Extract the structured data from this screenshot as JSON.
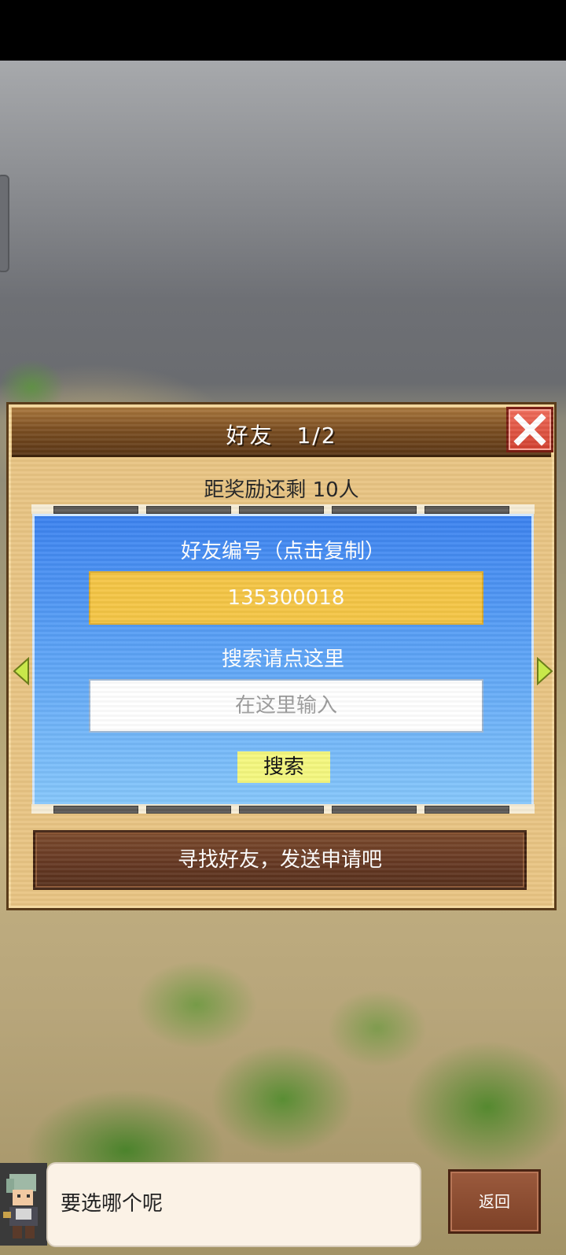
{
  "dialog": {
    "title": "好友　1/2",
    "reward_remaining": "距奖励还剩 10人",
    "friend_code_label": "好友编号（点击复制）",
    "friend_code": "135300018",
    "search_label": "搜索请点这里",
    "search_placeholder": "在这里输入",
    "search_button": "搜索",
    "find_friends_button": "寻找好友，发送申请吧"
  },
  "footer": {
    "chat_text": "要选哪个呢",
    "back_button": "返回"
  },
  "icons": {
    "close": "close-icon",
    "left_arrow": "arrow-left-icon",
    "right_arrow": "arrow-right-icon"
  },
  "colors": {
    "close_button": "#d1402f",
    "friend_code_bg": "#f4c545",
    "search_button_bg": "#f4f77e",
    "arrows": "#c8e84a"
  }
}
